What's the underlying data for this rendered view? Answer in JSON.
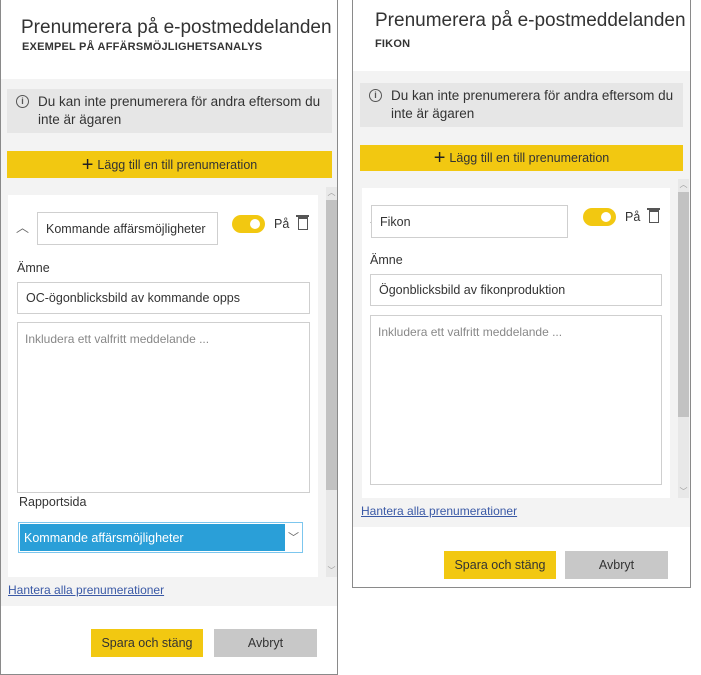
{
  "left": {
    "title": "Prenumerera på e-postmeddelanden",
    "subtitle": "EXEMPEL PÅ AFFÄRSMÖJLIGHETSANALYS",
    "info": "Du kan inte prenumerera för andra eftersom du inte är ägaren",
    "add_label": "Lägg till en till prenumeration",
    "subscription": {
      "name": "Kommande affärsmöjligheter",
      "toggle_label": "På",
      "toggle_on": true,
      "subject_label": "Ämne",
      "subject": "OC-ögonblicksbild av kommande opps",
      "message_placeholder": "Inkludera ett valfritt meddelande ...",
      "report_page_label": "Rapportsida",
      "report_page": "Kommande affärsmöjligheter"
    },
    "manage_link": "Hantera alla prenumerationer",
    "save": "Spara och stäng",
    "cancel": "Avbryt"
  },
  "right": {
    "title": "Prenumerera på e-postmeddelanden",
    "subtitle": "FIKON",
    "info": "Du kan inte prenumerera för andra eftersom du inte är ägaren",
    "add_label": "Lägg till en till prenumeration",
    "subscription": {
      "name": "Fikon",
      "toggle_label": "På",
      "toggle_on": true,
      "subject_label": "Ämne",
      "subject": "Ögonblicksbild av fikonproduktion",
      "message_placeholder": "Inkludera ett valfritt meddelande ..."
    },
    "manage_link": "Hantera alla prenumerationer",
    "save": "Spara och stäng",
    "cancel": "Avbryt"
  },
  "colors": {
    "accent": "#f2c811",
    "selected": "#2a9fd8",
    "link": "#3a59a6"
  }
}
